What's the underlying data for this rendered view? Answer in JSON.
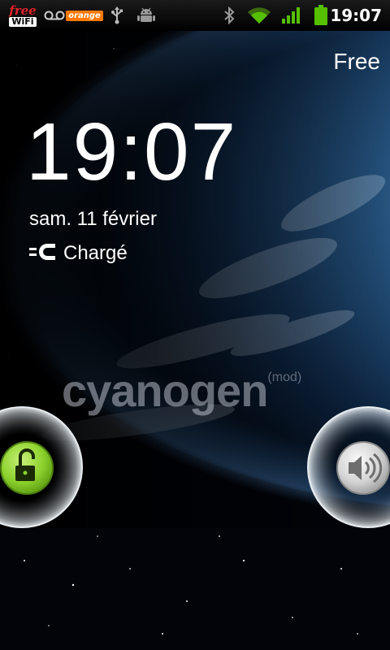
{
  "status_bar": {
    "carrier_badge": {
      "top": "free",
      "bottom": "WiFi"
    },
    "orange_label": "orange",
    "time": "19:07"
  },
  "lockscreen": {
    "operator": "Free",
    "time": "19:07",
    "date": "sam. 11 février",
    "charging_status": "Chargé",
    "brand_name": "cyanogen",
    "brand_suffix": "(mod)"
  },
  "icons": {
    "status_left": [
      "free-wifi-icon",
      "voicemail-icon",
      "orange-icon",
      "usb-icon",
      "android-debug-icon"
    ],
    "status_right": [
      "bluetooth-icon",
      "wifi-icon",
      "signal-icon",
      "battery-icon"
    ],
    "charge": "charging-plug-icon",
    "unlock": "unlock-icon",
    "sound": "speaker-icon"
  },
  "colors": {
    "unlock_accent": "#8bd12c",
    "status_icon_green": "#55c000",
    "free_red": "#e2232a",
    "orange_brand": "#ff7900"
  }
}
